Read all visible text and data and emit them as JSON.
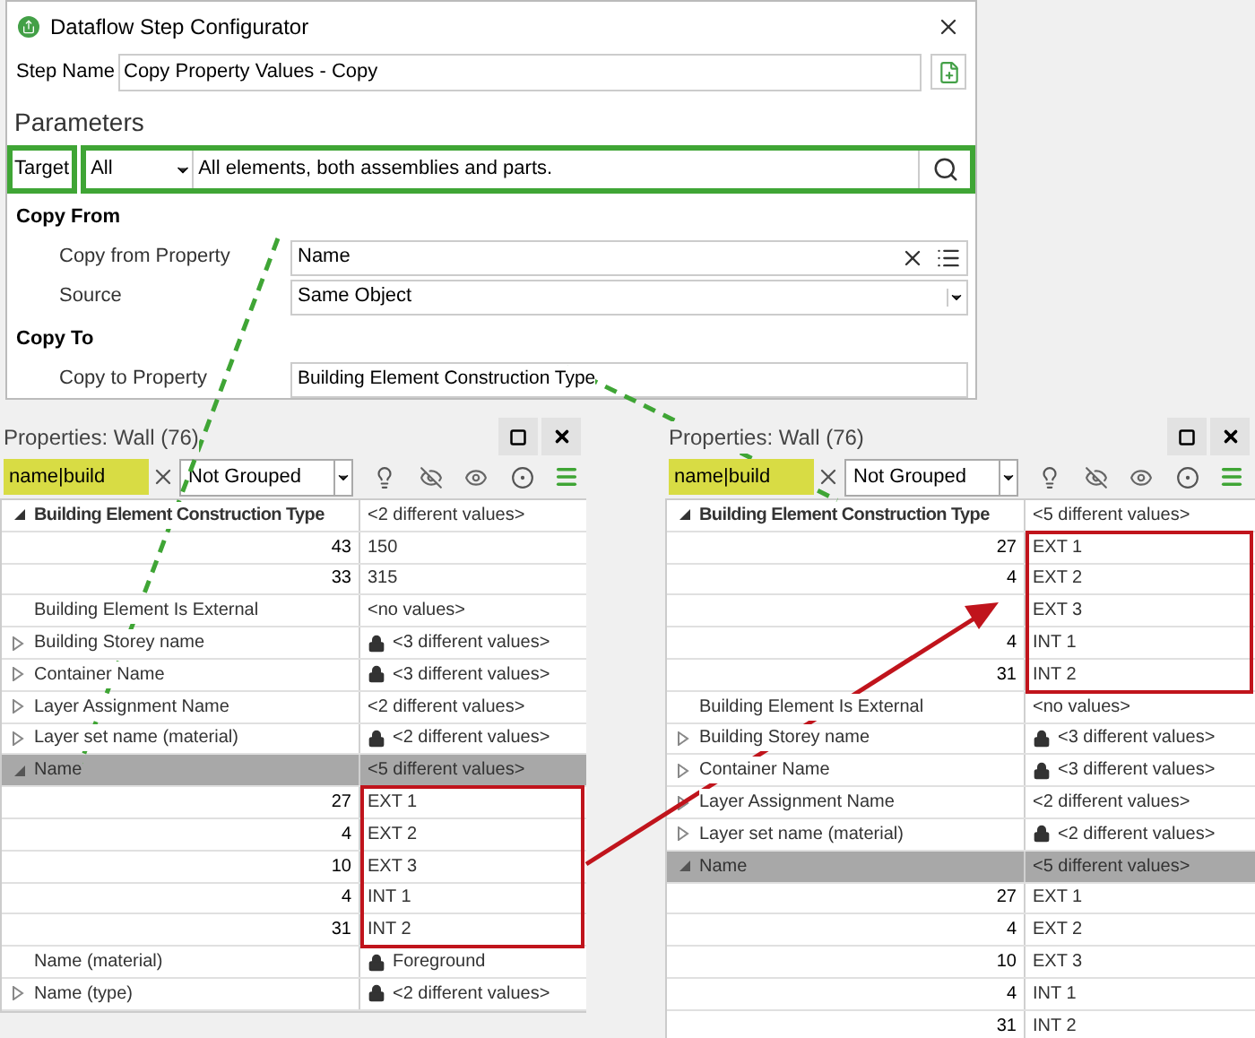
{
  "dialog": {
    "title": "Dataflow Step Configurator",
    "step_name": {
      "label": "Step Name",
      "value": "Copy Property Values - Copy"
    },
    "parameters_heading": "Parameters",
    "target": {
      "label": "Target",
      "scope": "All",
      "description": "All elements, both assemblies and parts."
    },
    "sections": [
      {
        "heading": "Copy From",
        "fields": [
          {
            "kind": "property",
            "label": "Copy from Property",
            "value": "Name"
          },
          {
            "kind": "dropdown",
            "label": "Source",
            "value": "Same Object"
          }
        ]
      },
      {
        "heading": "Copy To",
        "fields": [
          {
            "kind": "text",
            "label": "Copy to Property",
            "value": "Building Element Construction Type"
          }
        ]
      }
    ]
  },
  "panels": [
    {
      "title": "Properties: Wall (76)",
      "search": {
        "value": "name|build"
      },
      "grouping": "Not Grouped",
      "rows": [
        {
          "kind": "group",
          "name": "Building Element Construction Type",
          "value": "<2 different values>",
          "emphasized": true,
          "selected": false
        },
        {
          "kind": "count",
          "count": "43",
          "value": "150",
          "framed": false
        },
        {
          "kind": "count",
          "count": "33",
          "value": "315",
          "framed": false
        },
        {
          "kind": "property",
          "name": "Building Element Is External",
          "value": "<no values>",
          "expandable": false,
          "locked": false
        },
        {
          "kind": "property",
          "name": "Building Storey name",
          "value": "<3 different values>",
          "expandable": true,
          "locked": true
        },
        {
          "kind": "property",
          "name": "Container Name",
          "value": "<3 different values>",
          "expandable": true,
          "locked": true
        },
        {
          "kind": "property",
          "name": "Layer Assignment Name",
          "value": "<2 different values>",
          "expandable": true,
          "locked": false
        },
        {
          "kind": "property",
          "name": "Layer set name (material)",
          "value": "<2 different values>",
          "expandable": true,
          "locked": true
        },
        {
          "kind": "group",
          "name": "Name",
          "value": "<5 different values>",
          "emphasized": false,
          "selected": true
        },
        {
          "kind": "count",
          "count": "27",
          "value": "EXT 1",
          "framed": true
        },
        {
          "kind": "count",
          "count": "4",
          "value": "EXT 2",
          "framed": true
        },
        {
          "kind": "count",
          "count": "10",
          "value": "EXT 3",
          "framed": true
        },
        {
          "kind": "count",
          "count": "4",
          "value": "INT 1",
          "framed": true
        },
        {
          "kind": "count",
          "count": "31",
          "value": "INT 2",
          "framed": true
        },
        {
          "kind": "property",
          "name": "Name (material)",
          "value": "Foreground",
          "expandable": false,
          "locked": true
        },
        {
          "kind": "property",
          "name": "Name (type)",
          "value": "<2 different values>",
          "expandable": true,
          "locked": true
        }
      ]
    },
    {
      "title": "Properties: Wall (76)",
      "search": {
        "value": "name|build"
      },
      "grouping": "Not Grouped",
      "rows": [
        {
          "kind": "group",
          "name": "Building Element Construction Type",
          "value": "<5 different values>",
          "emphasized": true,
          "selected": false
        },
        {
          "kind": "count",
          "count": "27",
          "value": "EXT 1",
          "framed": true
        },
        {
          "kind": "count",
          "count": "4",
          "value": "EXT 2",
          "framed": true
        },
        {
          "kind": "count",
          "value": "EXT 3",
          "framed": true
        },
        {
          "kind": "count",
          "count": "4",
          "value": "INT 1",
          "framed": true
        },
        {
          "kind": "count",
          "count": "31",
          "value": "INT 2",
          "framed": true
        },
        {
          "kind": "property",
          "name": "Building Element Is External",
          "value": "<no values>",
          "expandable": false,
          "locked": false
        },
        {
          "kind": "property",
          "name": "Building Storey name",
          "value": "<3 different values>",
          "expandable": true,
          "locked": true
        },
        {
          "kind": "property",
          "name": "Container Name",
          "value": "<3 different values>",
          "expandable": true,
          "locked": true
        },
        {
          "kind": "property",
          "name": "Layer Assignment Name",
          "value": "<2 different values>",
          "expandable": true,
          "locked": false
        },
        {
          "kind": "property",
          "name": "Layer set name (material)",
          "value": "<2 different values>",
          "expandable": true,
          "locked": true
        },
        {
          "kind": "group",
          "name": "Name",
          "value": "<5 different values>",
          "emphasized": false,
          "selected": true
        },
        {
          "kind": "count",
          "count": "27",
          "value": "EXT 1",
          "framed": false
        },
        {
          "kind": "count",
          "count": "4",
          "value": "EXT 2",
          "framed": false
        },
        {
          "kind": "count",
          "count": "10",
          "value": "EXT 3",
          "framed": false
        },
        {
          "kind": "count",
          "count": "4",
          "value": "INT 1",
          "framed": false
        },
        {
          "kind": "count",
          "count": "31",
          "value": "INT 2",
          "framed": false
        }
      ]
    }
  ]
}
